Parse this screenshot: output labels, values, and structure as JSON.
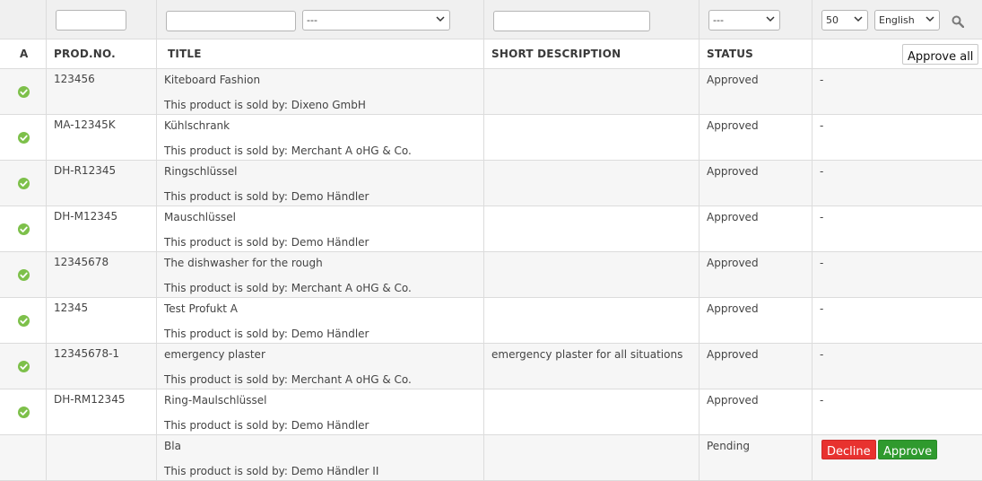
{
  "filters": {
    "title_select": "---",
    "status_select": "---",
    "per_page": "50",
    "language": "English"
  },
  "columns": {
    "active": "A",
    "prod_no": "PROD.NO.",
    "title": "TITLE",
    "short_description": "SHORT DESCRIPTION",
    "status": "STATUS"
  },
  "approve_all_label": "Approve all",
  "rows": [
    {
      "active": true,
      "prod_no": "123456",
      "title": "Kiteboard Fashion",
      "seller": "This product is sold by: Dixeno GmbH",
      "short_description": "",
      "status": "Approved",
      "action": "-"
    },
    {
      "active": true,
      "prod_no": "MA-12345K",
      "title": "Kühlschrank",
      "seller": "This product is sold by: Merchant A oHG & Co.",
      "short_description": "",
      "status": "Approved",
      "action": "-"
    },
    {
      "active": true,
      "prod_no": "DH-R12345",
      "title": "Ringschlüssel",
      "seller": "This product is sold by: Demo Händler",
      "short_description": "",
      "status": "Approved",
      "action": "-"
    },
    {
      "active": true,
      "prod_no": "DH-M12345",
      "title": "Mauschlüssel",
      "seller": "This product is sold by: Demo Händler",
      "short_description": "",
      "status": "Approved",
      "action": "-"
    },
    {
      "active": true,
      "prod_no": "12345678",
      "title": "The dishwasher for the rough",
      "seller": "This product is sold by: Merchant A oHG & Co.",
      "short_description": "",
      "status": "Approved",
      "action": "-"
    },
    {
      "active": true,
      "prod_no": "12345",
      "title": "Test Profukt A",
      "seller": "This product is sold by: Demo Händler",
      "short_description": "",
      "status": "Approved",
      "action": "-"
    },
    {
      "active": true,
      "prod_no": "12345678-1",
      "title": "emergency plaster",
      "seller": "This product is sold by: Merchant A oHG & Co.",
      "short_description": "emergency plaster for all situations",
      "status": "Approved",
      "action": "-"
    },
    {
      "active": true,
      "prod_no": "DH-RM12345",
      "title": "Ring-Maulschlüssel",
      "seller": "This product is sold by: Demo Händler",
      "short_description": "",
      "status": "Approved",
      "action": "-"
    },
    {
      "active": false,
      "prod_no": "",
      "title": "Bla",
      "seller": "This product is sold by: Demo Händler II",
      "short_description": "",
      "status": "Pending",
      "decline_label": "Decline",
      "approve_label": "Approve"
    }
  ],
  "colors": {
    "check_green": "#7dc04a",
    "decline_red": "#e8322f",
    "approve_green": "#2f9a2e"
  }
}
